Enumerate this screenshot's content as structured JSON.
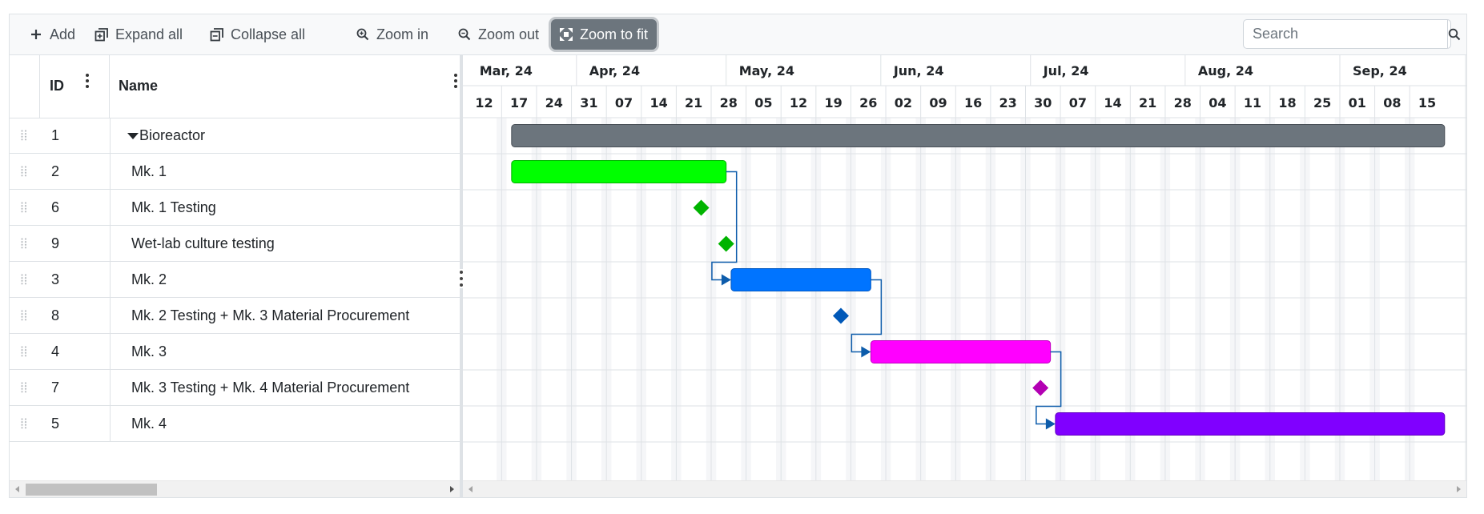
{
  "toolbar": {
    "add_label": "Add",
    "expand_all_label": "Expand all",
    "collapse_all_label": "Collapse all",
    "zoom_in_label": "Zoom in",
    "zoom_out_label": "Zoom out",
    "zoom_to_fit_label": "Zoom to fit",
    "search_placeholder": "Search",
    "search_value": ""
  },
  "grid": {
    "columns": {
      "id": "ID",
      "name": "Name"
    },
    "rows": [
      {
        "id": "1",
        "name": "Bioreactor",
        "level": 0,
        "expanded": true
      },
      {
        "id": "2",
        "name": "Mk. 1",
        "level": 1
      },
      {
        "id": "6",
        "name": "Mk. 1 Testing",
        "level": 1
      },
      {
        "id": "9",
        "name": "Wet-lab culture testing",
        "level": 1
      },
      {
        "id": "3",
        "name": "Mk. 2",
        "level": 1
      },
      {
        "id": "8",
        "name": "Mk. 2 Testing + Mk. 3 Material Procurement",
        "level": 1
      },
      {
        "id": "4",
        "name": "Mk. 3",
        "level": 1
      },
      {
        "id": "7",
        "name": "Mk. 3 Testing + Mk. 4 Material Procurement",
        "level": 1
      },
      {
        "id": "5",
        "name": "Mk. 4",
        "level": 1
      }
    ]
  },
  "timeline": {
    "start_date": "2024-03-10",
    "end_date": "2024-09-21",
    "months": [
      {
        "label": "Mar, 24",
        "start": "2024-03-10"
      },
      {
        "label": "Apr, 24",
        "start": "2024-04-01"
      },
      {
        "label": "May, 24",
        "start": "2024-05-01"
      },
      {
        "label": "Jun, 24",
        "start": "2024-06-01"
      },
      {
        "label": "Jul, 24",
        "start": "2024-07-01"
      },
      {
        "label": "Aug, 24",
        "start": "2024-08-01"
      },
      {
        "label": "Sep, 24",
        "start": "2024-09-01"
      }
    ],
    "weeks": [
      {
        "label": "12",
        "start": "2024-03-10"
      },
      {
        "label": "17",
        "start": "2024-03-17"
      },
      {
        "label": "24",
        "start": "2024-03-24"
      },
      {
        "label": "31",
        "start": "2024-03-31"
      },
      {
        "label": "07",
        "start": "2024-04-07"
      },
      {
        "label": "14",
        "start": "2024-04-14"
      },
      {
        "label": "21",
        "start": "2024-04-21"
      },
      {
        "label": "28",
        "start": "2024-04-28"
      },
      {
        "label": "05",
        "start": "2024-05-05"
      },
      {
        "label": "12",
        "start": "2024-05-12"
      },
      {
        "label": "19",
        "start": "2024-05-19"
      },
      {
        "label": "26",
        "start": "2024-05-26"
      },
      {
        "label": "02",
        "start": "2024-06-02"
      },
      {
        "label": "09",
        "start": "2024-06-09"
      },
      {
        "label": "16",
        "start": "2024-06-16"
      },
      {
        "label": "23",
        "start": "2024-06-23"
      },
      {
        "label": "30",
        "start": "2024-06-30"
      },
      {
        "label": "07",
        "start": "2024-07-07"
      },
      {
        "label": "14",
        "start": "2024-07-14"
      },
      {
        "label": "21",
        "start": "2024-07-21"
      },
      {
        "label": "28",
        "start": "2024-07-28"
      },
      {
        "label": "04",
        "start": "2024-08-04"
      },
      {
        "label": "11",
        "start": "2024-08-11"
      },
      {
        "label": "18",
        "start": "2024-08-18"
      },
      {
        "label": "25",
        "start": "2024-08-25"
      },
      {
        "label": "01",
        "start": "2024-09-01"
      },
      {
        "label": "08",
        "start": "2024-09-08"
      },
      {
        "label": "15",
        "start": "2024-09-15"
      }
    ]
  },
  "tasks": [
    {
      "id": "1",
      "type": "summary",
      "start": "2024-03-19",
      "end": "2024-09-22",
      "color": "#6c757d",
      "border": "#495057"
    },
    {
      "id": "2",
      "type": "task",
      "start": "2024-03-19",
      "end": "2024-05-01",
      "color": "#00ff00",
      "border": "#00b300"
    },
    {
      "id": "6",
      "type": "milestone",
      "date": "2024-04-26",
      "color": "#00b300"
    },
    {
      "id": "9",
      "type": "milestone",
      "date": "2024-05-01",
      "color": "#00b300"
    },
    {
      "id": "3",
      "type": "task",
      "start": "2024-05-02",
      "end": "2024-05-30",
      "color": "#0074ff",
      "border": "#0058c2"
    },
    {
      "id": "8",
      "type": "milestone",
      "date": "2024-05-24",
      "color": "#0058b8"
    },
    {
      "id": "4",
      "type": "task",
      "start": "2024-05-30",
      "end": "2024-07-05",
      "color": "#ff00ff",
      "border": "#c000c0"
    },
    {
      "id": "7",
      "type": "milestone",
      "date": "2024-07-03",
      "color": "#b300b3"
    },
    {
      "id": "5",
      "type": "task",
      "start": "2024-07-06",
      "end": "2024-09-22",
      "color": "#8000ff",
      "border": "#6000c0"
    }
  ],
  "dependencies": [
    {
      "from": "2",
      "to": "3"
    },
    {
      "from": "3",
      "to": "4"
    },
    {
      "from": "4",
      "to": "5"
    }
  ],
  "colors": {
    "link": "#0d5cab",
    "grid_line": "#dee2e6",
    "weekend": "#f5f6f8",
    "header_text": "#212529"
  }
}
